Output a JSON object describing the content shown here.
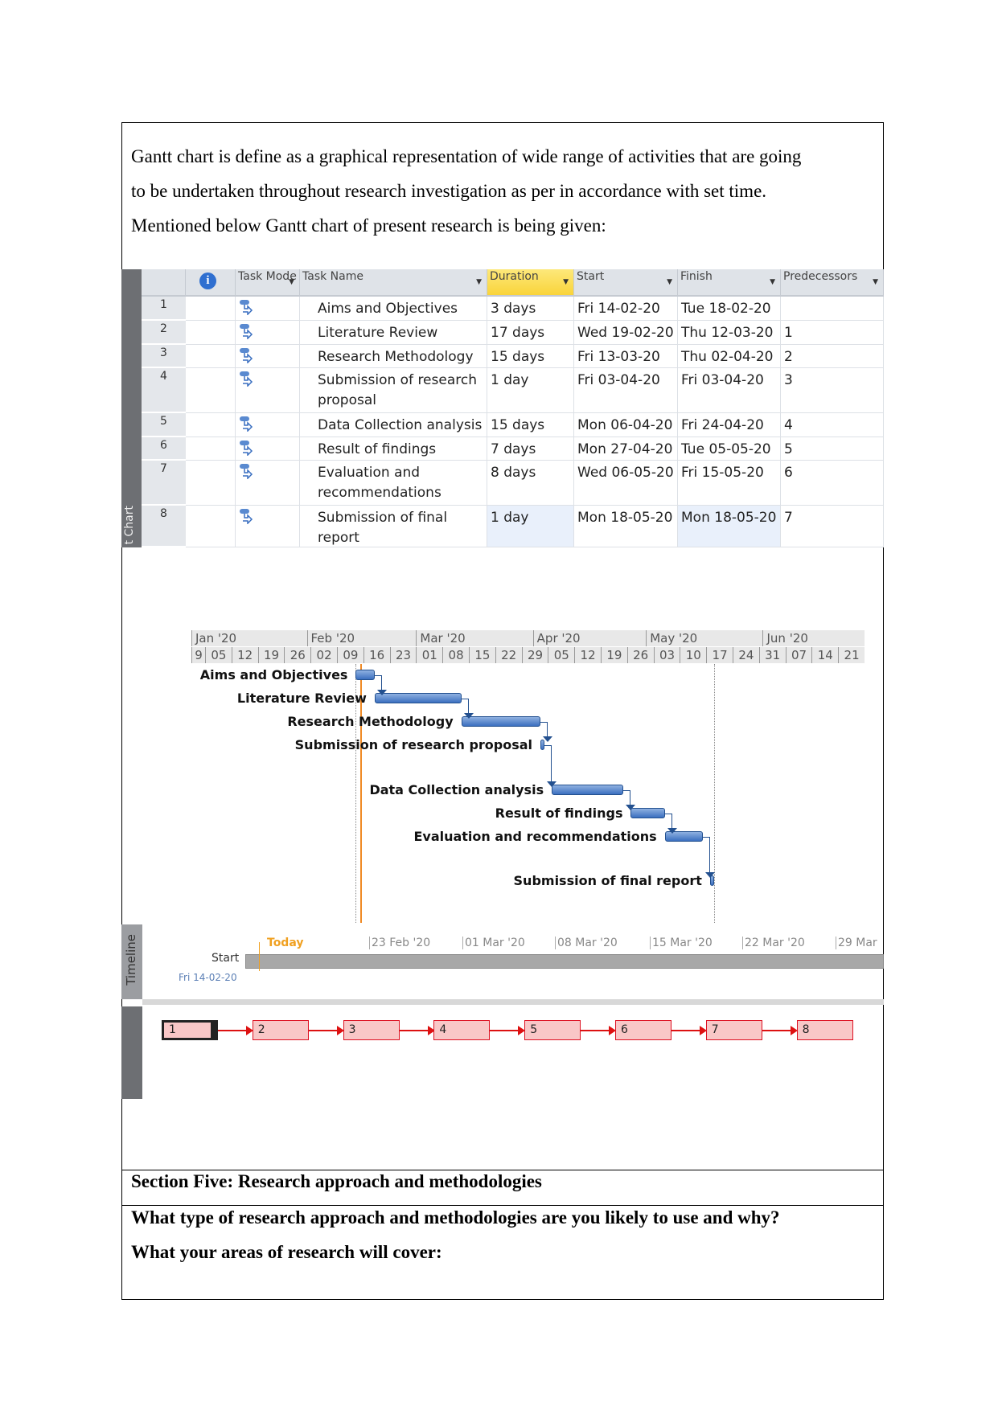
{
  "intro": {
    "lines": [
      "Gantt chart is define as a graphical representation of wide range of activities that are going",
      "to be undertaken throughout research investigation as per in accordance with set time.",
      "Mentioned below Gantt chart of present research is being given:"
    ]
  },
  "table": {
    "side_label": "t Chart",
    "headers": [
      "Task Mode",
      "Task Name",
      "Duration",
      "Start",
      "Finish",
      "Predecessors"
    ],
    "info_icon": "info-icon",
    "tasks": [
      {
        "id": "1",
        "name": "Aims and Objectives",
        "duration": "3 days",
        "start": "Fri 14-02-20",
        "finish": "Tue 18-02-20",
        "pred": ""
      },
      {
        "id": "2",
        "name": "Literature Review",
        "duration": "17 days",
        "start": "Wed 19-02-20",
        "finish": "Thu 12-03-20",
        "pred": "1"
      },
      {
        "id": "3",
        "name": "Research Methodology",
        "duration": "15 days",
        "start": "Fri 13-03-20",
        "finish": "Thu 02-04-20",
        "pred": "2"
      },
      {
        "id": "4",
        "name": "Submission of research proposal",
        "duration": "1 day",
        "start": "Fri 03-04-20",
        "finish": "Fri 03-04-20",
        "pred": "3"
      },
      {
        "id": "5",
        "name": "Data Collection analysis",
        "duration": "15 days",
        "start": "Mon 06-04-20",
        "finish": "Fri 24-04-20",
        "pred": "4"
      },
      {
        "id": "6",
        "name": "Result of findings",
        "duration": "7 days",
        "start": "Mon 27-04-20",
        "finish": "Tue 05-05-20",
        "pred": "5"
      },
      {
        "id": "7",
        "name": "Evaluation and recommendations",
        "duration": "8 days",
        "start": "Wed 06-05-20",
        "finish": "Fri 15-05-20",
        "pred": "6"
      },
      {
        "id": "8",
        "name": "Submission of final report",
        "duration": "1 day",
        "start": "Mon 18-05-20",
        "finish": "Mon 18-05-20",
        "pred": "7"
      }
    ]
  },
  "gantt": {
    "months": [
      "Jan '20",
      "Feb '20",
      "Mar '20",
      "Apr '20",
      "May '20",
      "Jun '20"
    ],
    "weeks": [
      "9",
      "05",
      "12",
      "19",
      "26",
      "02",
      "09",
      "16",
      "23",
      "01",
      "08",
      "15",
      "22",
      "29",
      "05",
      "12",
      "19",
      "26",
      "03",
      "10",
      "17",
      "24",
      "31",
      "07",
      "14",
      "21"
    ],
    "bar_color": "#3b6fbf",
    "today_color": "#f08a24"
  },
  "timeline": {
    "label": "Timeline",
    "today": "Today",
    "start_label": "Start",
    "start_date": "Fri 14-02-20",
    "ticks": [
      "23 Feb '20",
      "01 Mar '20",
      "08 Mar '20",
      "15 Mar '20",
      "22 Mar '20",
      "29 Mar"
    ]
  },
  "network": {
    "nodes": [
      "1",
      "2",
      "3",
      "4",
      "5",
      "6",
      "7",
      "8"
    ],
    "color": "#dd1111"
  },
  "section": {
    "title": "Section Five: Research approach and methodologies",
    "q1": "What type of research approach and methodologies are you likely to use and why?",
    "q2": "What your areas of research will cover:"
  }
}
